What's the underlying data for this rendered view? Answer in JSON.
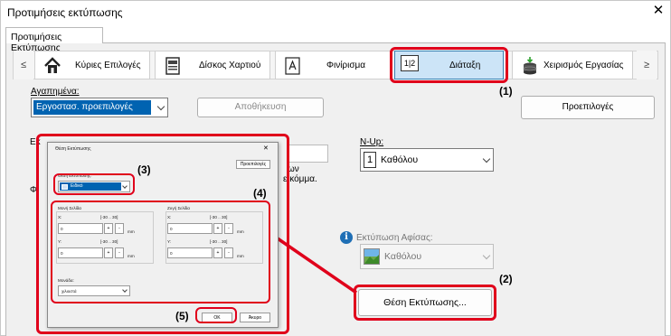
{
  "window": {
    "title": "Προτιμήσεις εκτύπωσης",
    "close_glyph": "✕"
  },
  "tab": {
    "label": "Προτιμήσεις Εκτύπωσης"
  },
  "nav": {
    "scroll_left": "≤",
    "scroll_right": "≥",
    "items": [
      {
        "label": "Κύριες Επιλογές",
        "icon": "home-icon"
      },
      {
        "label": "Δίσκος Χαρτιού",
        "icon": "paper-tray-icon"
      },
      {
        "label": "Φινίρισμα",
        "icon": "finishing-icon"
      },
      {
        "label": "Διάταξη",
        "icon": "layout-icon",
        "icon_text": "1|2",
        "selected": true
      },
      {
        "label": "Χειρισμός Εργασίας",
        "icon": "job-handling-icon"
      }
    ]
  },
  "favorites": {
    "label": "Αγαπημένα:",
    "selected": "Εργοστασ. προεπιλογές",
    "save_button": "Αποθήκευση",
    "defaults_button": "Προεπιλογές"
  },
  "behind": {
    "letter_a": "Εκ",
    "letter_b": "Φ",
    "text_1": "ων",
    "text_2": "ε κόμμα."
  },
  "nup": {
    "label": "N-Up:",
    "value": "Καθόλου",
    "icon_text": "1"
  },
  "poster": {
    "label": "Εκτύπωση Αφίσας:",
    "value": "Καθόλου",
    "info_glyph": "i"
  },
  "print_position_button": "Θέση Εκτύπωσης...",
  "callouts": {
    "c1": "(1)",
    "c2": "(2)",
    "c3": "(3)",
    "c4": "(4)",
    "c5": "(5)"
  },
  "dialog": {
    "title": "Θέση Εκτύπωσης",
    "close_glyph": "✕",
    "defaults_button": "Προεπιλογές",
    "position_label": "Θέση Εκτύπωσης:",
    "position_value": "Ειδικό",
    "odd_page": {
      "label": "Μονή Σελίδα",
      "x_label": "X:",
      "x_range": "[-30 .. 30]",
      "x_value": "0",
      "y_label": "Y:",
      "y_range": "[-30 .. 30]",
      "y_value": "0",
      "unit": "mm"
    },
    "even_page": {
      "label": "Ζυγή Σελίδα",
      "x_label": "X:",
      "x_range": "[-30 .. 30]",
      "x_value": "0",
      "y_label": "Y:",
      "y_range": "[-30 .. 30]",
      "y_value": "0",
      "unit": "mm"
    },
    "plus": "+",
    "minus": "-",
    "unit_label": "Μονάδα:",
    "unit_value": "χιλιοστά",
    "ok_button": "OK",
    "cancel_button": "Άκυρο"
  },
  "colors": {
    "highlight": "#e0001b",
    "selection": "#0063b1",
    "selected_tab": "#cce4f7"
  }
}
